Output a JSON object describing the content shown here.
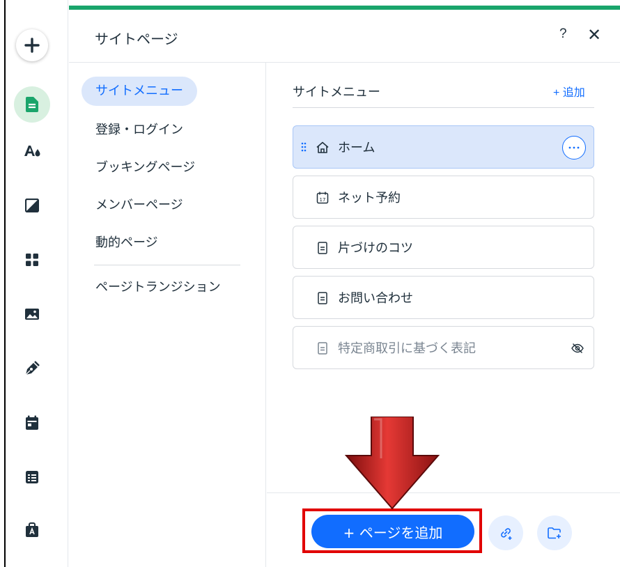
{
  "panel": {
    "title": "サイトページ",
    "help_label": "?",
    "close_label": "✕"
  },
  "rail": {
    "icons": [
      "add-icon",
      "pages-icon",
      "design-icon",
      "background-icon",
      "apps-icon",
      "media-icon",
      "blog-icon",
      "bookings-icon",
      "cms-icon",
      "business-icon"
    ]
  },
  "nav": {
    "items": [
      {
        "label": "サイトメニュー",
        "active": true
      },
      {
        "label": "登録・ログイン"
      },
      {
        "label": "ブッキングページ"
      },
      {
        "label": "メンバーページ"
      },
      {
        "label": "動的ページ"
      },
      {
        "label": "ページトランジション"
      }
    ]
  },
  "list": {
    "title": "サイトメニュー",
    "add_label": "+ 追加",
    "pages": [
      {
        "label": "ホーム",
        "icon": "home-icon",
        "selected": true
      },
      {
        "label": "ネット予約",
        "icon": "calendar-icon"
      },
      {
        "label": "片づけのコツ",
        "icon": "page-icon"
      },
      {
        "label": "お問い合わせ",
        "icon": "page-icon"
      },
      {
        "label": "特定商取引に基づく表記",
        "icon": "page-icon",
        "hidden": true
      }
    ]
  },
  "footer": {
    "add_page_label": "+ ページを追加"
  },
  "colors": {
    "accent": "#116dff",
    "brand_green": "#1aa56b",
    "highlight_red": "#e10000",
    "arrow_red": "#c62828"
  }
}
